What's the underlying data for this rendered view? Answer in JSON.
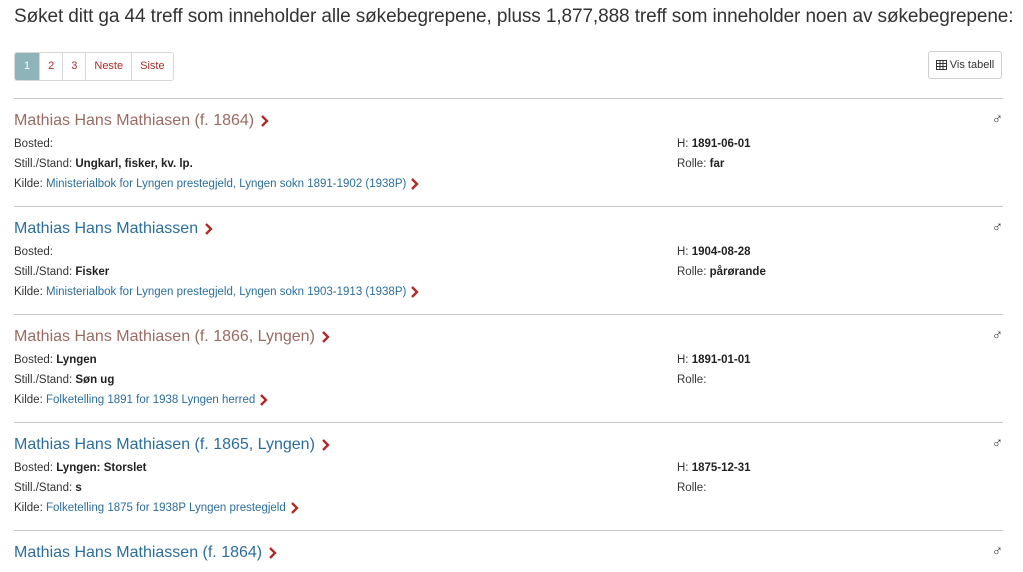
{
  "summary": "Søket ditt ga 44 treff som inneholder alle søkebegrepene, pluss 1,877,888 treff som inneholder noen av søkebegrepene:",
  "pagination": {
    "pages": [
      "1",
      "2",
      "3"
    ],
    "next": "Neste",
    "last": "Siste",
    "active": "1"
  },
  "vis_tabell": {
    "label": "Vis tabell",
    "icon": "table-icon"
  },
  "labels": {
    "bosted": "Bosted:",
    "still": "Still./Stand:",
    "kilde": "Kilde:",
    "h": "H:",
    "rolle": "Rolle:"
  },
  "gender_symbol": "♂",
  "colors": {
    "link": "#2b6e9e",
    "visited": "#9a6b63",
    "chevron": "#b02a2a",
    "active_page": "#8db4b8"
  },
  "results": [
    {
      "name": "Mathias Hans Mathiasen (f. 1864)",
      "visited": true,
      "bosted": "",
      "still": "Ungkarl, fisker, kv. lp.",
      "kilde": "Ministerialbok for Lyngen prestegjeld, Lyngen sokn 1891-1902 (1938P)",
      "h": "1891-06-01",
      "rolle": "far"
    },
    {
      "name": "Mathias Hans Mathiassen",
      "visited": false,
      "bosted": "",
      "still": "Fisker",
      "kilde": "Ministerialbok for Lyngen prestegjeld, Lyngen sokn 1903-1913 (1938P)",
      "h": "1904-08-28",
      "rolle": "pårørande"
    },
    {
      "name": "Mathias Hans Mathiasen (f. 1866, Lyngen)",
      "visited": true,
      "bosted": "Lyngen",
      "still": "Søn ug",
      "kilde": "Folketelling 1891 for 1938 Lyngen herred",
      "h": "1891-01-01",
      "rolle": ""
    },
    {
      "name": "Mathias Hans Mathiasen (f. 1865, Lyngen)",
      "visited": false,
      "bosted": "Lyngen: Storslet",
      "still": "s",
      "kilde": "Folketelling 1875 for 1938P Lyngen prestegjeld",
      "h": "1875-12-31",
      "rolle": ""
    },
    {
      "name": "Mathias Hans Mathiassen (f. 1864)",
      "visited": false
    }
  ]
}
